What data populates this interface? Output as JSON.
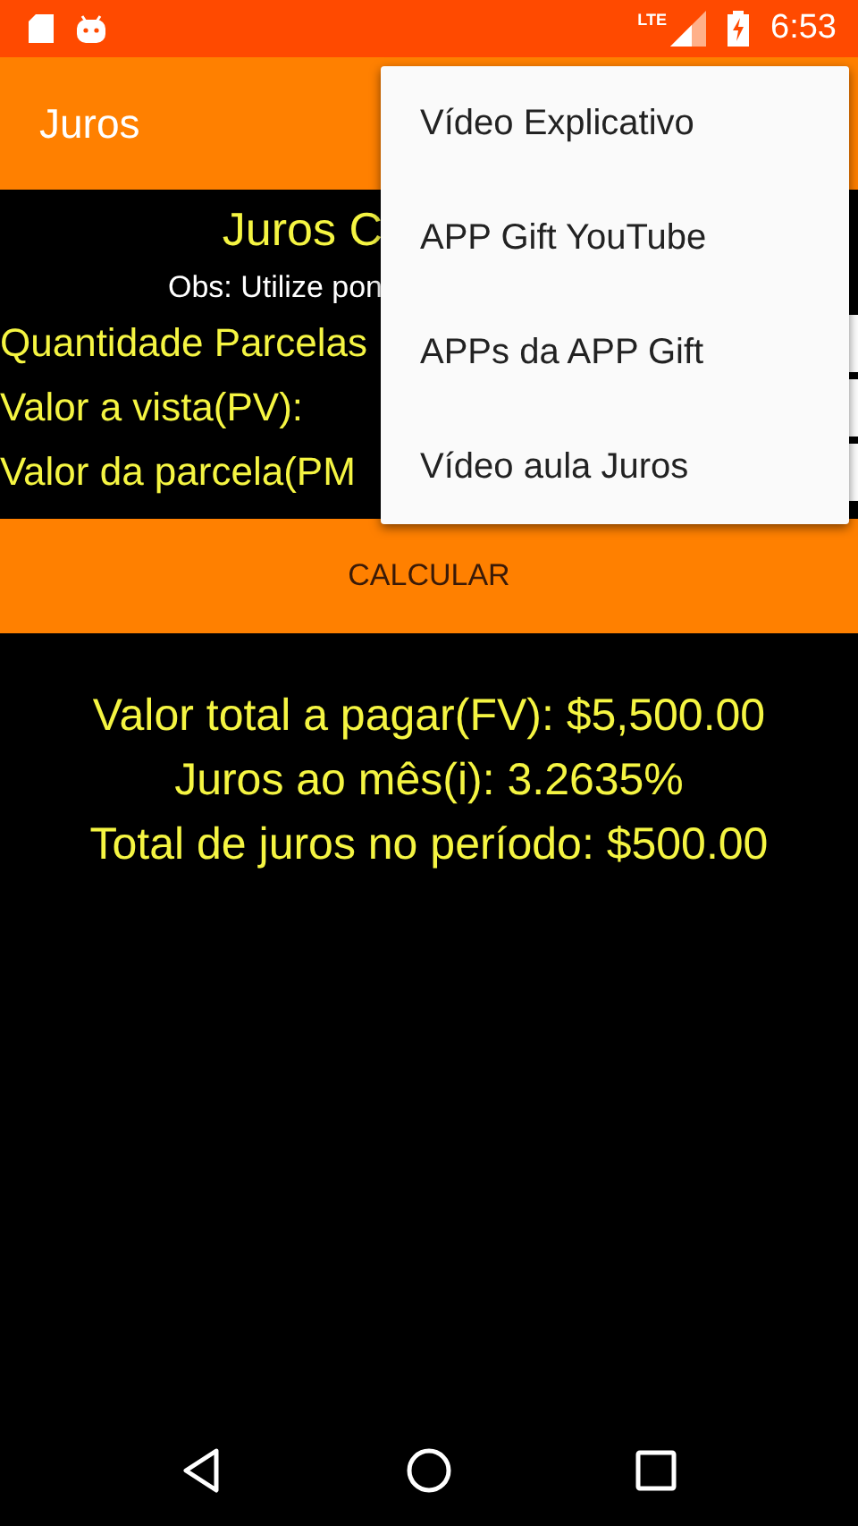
{
  "status_bar": {
    "network": "LTE",
    "time": "6:53"
  },
  "app_bar": {
    "title": "Juros"
  },
  "form": {
    "title": "Juros C",
    "note": "Obs: Utilize pon",
    "fields": [
      {
        "label": "Quantidade Parcelas"
      },
      {
        "label": "Valor a vista(PV):"
      },
      {
        "label": "Valor da parcela(PM"
      }
    ]
  },
  "calculate_button": "CALCULAR",
  "results": [
    "Valor total a pagar(FV): $5,500.00",
    "Juros ao mês(i): 3.2635%",
    "Total de juros no período: $500.00"
  ],
  "menu": {
    "items": [
      "Vídeo Explicativo",
      "APP Gift YouTube",
      "APPs da APP Gift",
      "Vídeo aula Juros"
    ]
  }
}
